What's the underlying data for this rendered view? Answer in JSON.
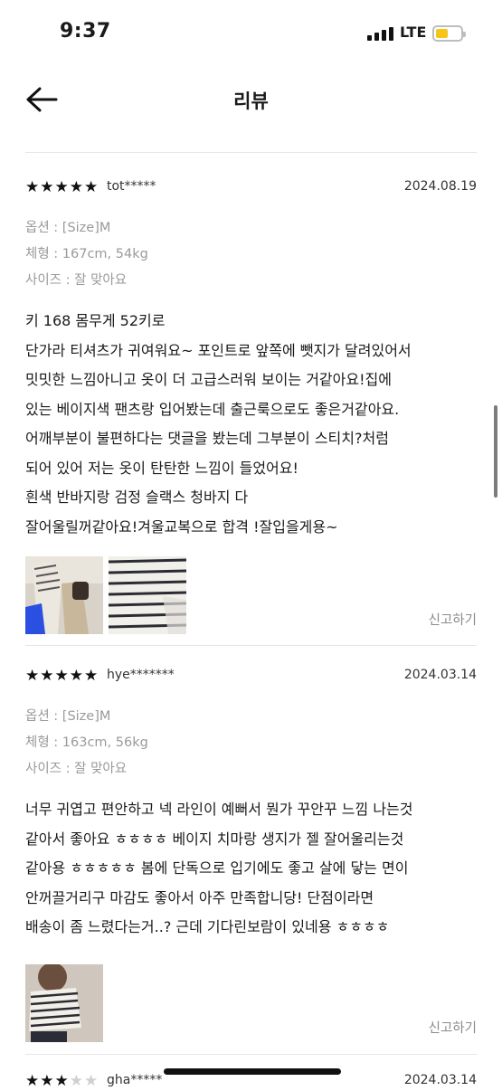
{
  "status": {
    "time": "9:37",
    "network": "LTE",
    "battery_color": "#f5c518"
  },
  "nav": {
    "title": "리뷰",
    "back_icon": "arrow-left-icon"
  },
  "reviews": [
    {
      "rating": 5,
      "user": "tot*****",
      "date": "2024.08.19",
      "option": "옵션 : [Size]M",
      "body_type": "체형 : 167cm, 54kg",
      "size": "사이즈 : 잘 맞아요",
      "lines": [
        "키 168 몸무게 52키로",
        "단가라 티셔츠가 귀여워요~ 포인트로 앞쪽에 뺏지가 달려있어서",
        "밋밋한 느낌아니고 옷이 더 고급스러워 보이는 거같아요!집에",
        "있는 베이지색 팬츠랑 입어봤는데 출근룩으로도 좋은거같아요.",
        "어깨부분이 불편하다는 댓글을 봤는데 그부분이  스티치?처럼",
        "되어 있어 저는 옷이 탄탄한 느낌이 들었어요!",
        "흰색 반바지랑 검정 슬랙스 청바지 다",
        "잘어울릴꺼같아요!겨울교복으로 합격 !잘입을게용~"
      ],
      "report": "신고하기"
    },
    {
      "rating": 5,
      "user": "hye*******",
      "date": "2024.03.14",
      "option": "옵션 : [Size]M",
      "body_type": "체형 : 163cm, 56kg",
      "size": "사이즈 : 잘 맞아요",
      "lines": [
        "너무 귀엽고 편안하고 넥 라인이 예뻐서 뭔가 꾸안꾸 느낌 나는것",
        "같아서 좋아요 ㅎㅎㅎㅎ 베이지 치마랑 생지가 젤 잘어울리는것",
        "같아용 ㅎㅎㅎㅎㅎ 봄에 단독으로 입기에도 좋고 살에 닿는 면이",
        "안꺼끌거리구 마감도 좋아서 아주 만족합니당! 단점이라면",
        "배송이 좀 느렸다는거..? 근데 기다린보람이 있네용 ㅎㅎㅎㅎ"
      ],
      "report": "신고하기"
    },
    {
      "rating": 3,
      "user": "gha*****",
      "date": "2024.03.14"
    }
  ]
}
